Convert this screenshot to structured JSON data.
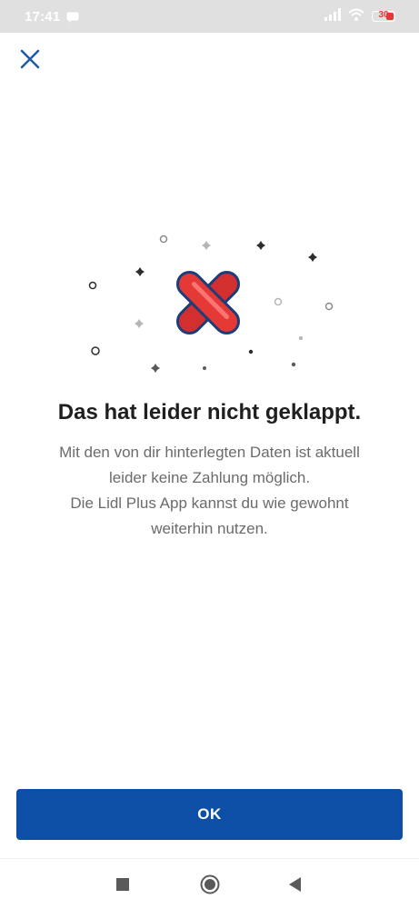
{
  "status_bar": {
    "time": "17:41",
    "battery": "30",
    "icons": [
      "message-icon",
      "signal-icon",
      "wifi-icon",
      "battery-icon"
    ]
  },
  "header": {
    "close_icon": "close-icon"
  },
  "illustration": {
    "icon": "red-x-icon",
    "accent_color": "#e53935"
  },
  "content": {
    "title": "Das hat leider nicht geklappt.",
    "line1": "Mit den von dir hinterlegten Daten ist aktuell",
    "line2": "leider keine Zahlung möglich.",
    "line3": "Die Lidl Plus App kannst du wie gewohnt",
    "line4": "weiterhin nutzen."
  },
  "actions": {
    "ok_label": "OK",
    "primary_color": "#0d4ea6"
  },
  "nav_bar": {
    "icons": [
      "recents-icon",
      "home-icon",
      "back-icon"
    ]
  }
}
